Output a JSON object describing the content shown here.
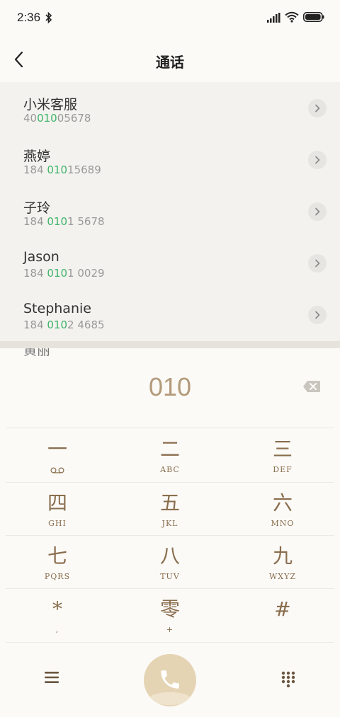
{
  "status_bar": {
    "time": "2:36"
  },
  "header": {
    "title": "通话"
  },
  "results": [
    {
      "name": "小米客服",
      "num_pre": "40",
      "num_hl": "010",
      "num_post": "05678"
    },
    {
      "name": "燕婷",
      "num_pre": "184 ",
      "num_hl": "010",
      "num_post": "15689"
    },
    {
      "name": "子玲",
      "num_pre": "184 ",
      "num_hl": "010",
      "num_post": "1 5678"
    },
    {
      "name": "Jason",
      "num_pre": "184 ",
      "num_hl": "010",
      "num_post": "1 0029"
    },
    {
      "name": "Stephanie",
      "num_pre": "184 ",
      "num_hl": "010",
      "num_post": "2 4685"
    }
  ],
  "partial_result_name": "黄丽",
  "dialer": {
    "number": "010",
    "keys": [
      {
        "glyph": "一",
        "letters": ""
      },
      {
        "glyph": "二",
        "letters": "ABC"
      },
      {
        "glyph": "三",
        "letters": "DEF"
      },
      {
        "glyph": "四",
        "letters": "GHI"
      },
      {
        "glyph": "五",
        "letters": "JKL"
      },
      {
        "glyph": "六",
        "letters": "MNO"
      },
      {
        "glyph": "七",
        "letters": "PQRS"
      },
      {
        "glyph": "八",
        "letters": "TUV"
      },
      {
        "glyph": "九",
        "letters": "WXYZ"
      },
      {
        "glyph": "*",
        "letters": ","
      },
      {
        "glyph": "零",
        "letters": "+"
      },
      {
        "glyph": "#",
        "letters": ""
      }
    ]
  },
  "colors": {
    "accent": "#8a6e4e",
    "highlight": "#3eb46a",
    "call_button": "#e5d4b4",
    "dialed_number": "#b39a7a"
  },
  "icons": [
    "bluetooth-icon",
    "signal-icon",
    "wifi-icon",
    "battery-icon",
    "back-icon",
    "chevron-right-icon",
    "backspace-icon",
    "voicemail-icon",
    "menu-icon",
    "phone-icon",
    "keypad-icon"
  ]
}
